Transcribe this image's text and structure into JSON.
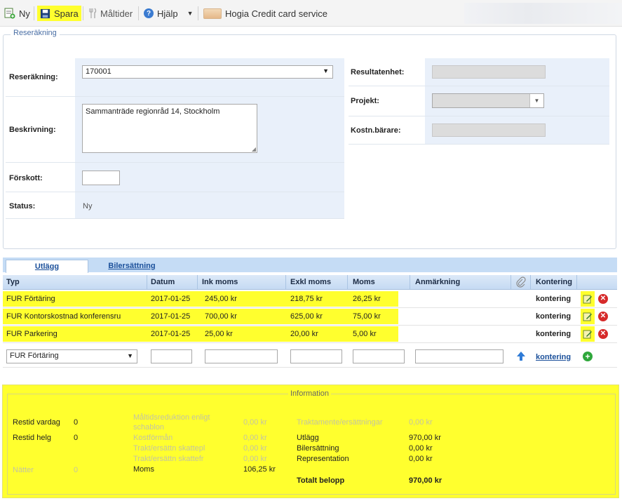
{
  "toolbar": {
    "new_label": "Ny",
    "save_label": "Spara",
    "meals_label": "Måltider",
    "help_label": "Hjälp",
    "ccs_label": "Hogia Credit card service"
  },
  "form": {
    "legend": "Reseräkning",
    "reserakning_label": "Reseräkning:",
    "reserakning_value": "170001",
    "beskrivning_label": "Beskrivning:",
    "beskrivning_value": "Sammanträde regionråd 14, Stockholm",
    "forskott_label": "Förskott:",
    "forskott_value": "",
    "status_label": "Status:",
    "status_value": "Ny",
    "resultatenhet_label": "Resultatenhet:",
    "projekt_label": "Projekt:",
    "kostn_label": "Kostn.bärare:"
  },
  "tabs": {
    "utlagg": "Utlägg",
    "bilersattning": "Bilersättning"
  },
  "table": {
    "columns": [
      "Typ",
      "Datum",
      "Ink moms",
      "Exkl moms",
      "Moms",
      "Anmärkning",
      "Kontering"
    ],
    "rows": [
      {
        "typ": "FUR Förtäring",
        "datum": "2017-01-25",
        "ink": "245,00 kr",
        "exkl": "218,75 kr",
        "moms": "26,25 kr",
        "kontering": "kontering"
      },
      {
        "typ": "FUR Kontorskostnad konferensru",
        "datum": "2017-01-25",
        "ink": "700,00 kr",
        "exkl": "625,00 kr",
        "moms": "75,00 kr",
        "kontering": "kontering"
      },
      {
        "typ": "FUR Parkering",
        "datum": "2017-01-25",
        "ink": "25,00 kr",
        "exkl": "20,00 kr",
        "moms": "5,00 kr",
        "kontering": "kontering"
      }
    ],
    "new_row": {
      "typ": "FUR Förtäring",
      "kontering": "kontering"
    }
  },
  "info": {
    "legend": "Information",
    "restid_vardag_label": "Restid vardag",
    "restid_vardag_value": "0",
    "restid_helg_label": "Restid helg",
    "restid_helg_value": "0",
    "natter_label": "Nätter",
    "natter_value": "0",
    "maltid_red_label": "Måltidsreduktion enligt schablon",
    "maltid_red_value": "0,00 kr",
    "kostforman_label": "Kostförmån",
    "kostforman_value": "0,00 kr",
    "trakt_skattepl_label": "Trakt/ersättn skattepl",
    "trakt_skattepl_value": "0,00 kr",
    "trakt_skattefr_label": "Trakt/ersättn skattefr",
    "trakt_skattefr_value": "0,00 kr",
    "moms_label": "Moms",
    "moms_value": "106,25 kr",
    "traktamente_label": "Traktamente/ersättningar",
    "traktamente_value": "0,00 kr",
    "utlagg_label": "Utlägg",
    "utlagg_value": "970,00 kr",
    "bilersattning_label": "Bilersättning",
    "bilersattning_value": "0,00 kr",
    "representation_label": "Representation",
    "representation_value": "0,00 kr",
    "totalt_label": "Totalt belopp",
    "totalt_value": "970,00 kr"
  },
  "colors": {
    "highlight": "#ffff2e",
    "header_blue": "#c5dcf5",
    "label_bg": "#e9f0fa"
  }
}
